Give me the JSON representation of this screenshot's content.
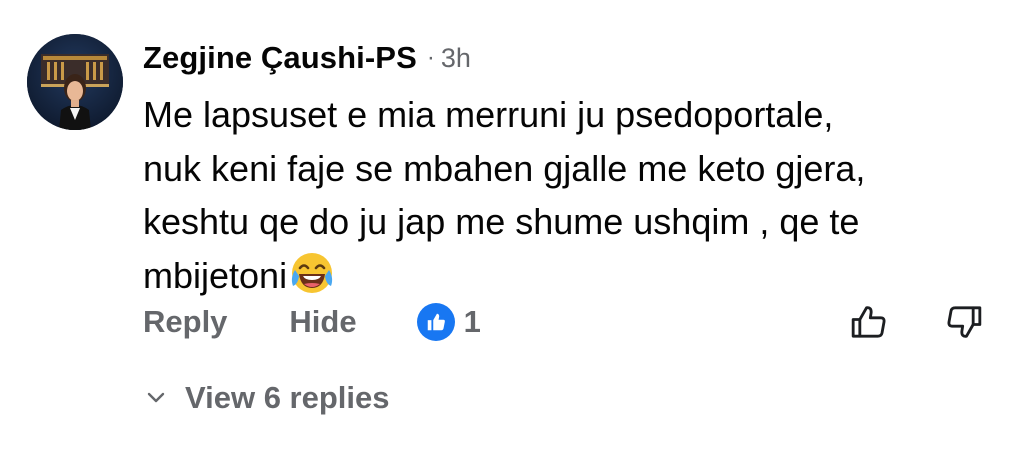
{
  "comment": {
    "author": "Zegjine Çaushi-PS",
    "separator": "·",
    "timestamp": "3h",
    "text_lines": [
      "Me lapsuset e mia merruni ju psedoportale,",
      "nuk keni faje se mbahen gjalle me keto gjera,",
      "keshtu qe do ju jap me shume ushqim , qe te",
      "mbijetoni"
    ],
    "emoji": "laughing-tears-emoji"
  },
  "actions": {
    "reply_label": "Reply",
    "hide_label": "Hide",
    "reaction_icon": "like-icon",
    "reaction_count": "1",
    "upvote_icon": "thumbs-up-outline-icon",
    "downvote_icon": "thumbs-down-outline-icon"
  },
  "replies": {
    "label": "View 6 replies",
    "icon": "chevron-down-icon"
  },
  "colors": {
    "text_primary": "#050505",
    "text_secondary": "#65676b",
    "like_blue": "#1877f2",
    "emoji_yellow": "#f7c531"
  }
}
